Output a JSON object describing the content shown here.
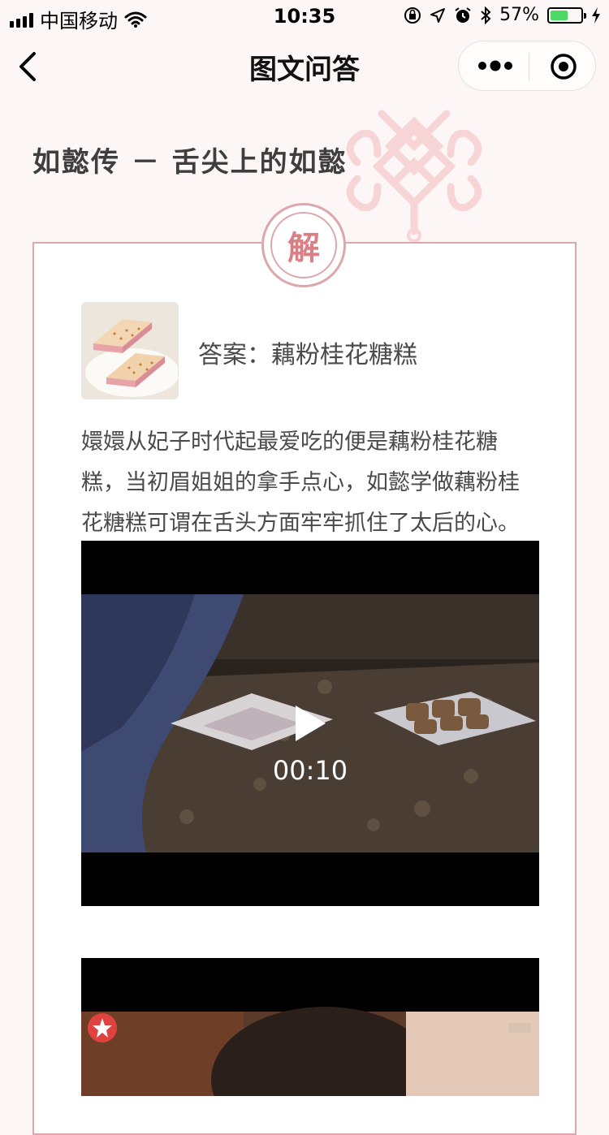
{
  "status_bar": {
    "carrier": "中国移动",
    "time": "10:35",
    "battery": "57%",
    "battery_level": 0.57
  },
  "nav": {
    "title": "图文问答",
    "icons": [
      "chevron-left-icon",
      "more-dots-icon",
      "target-close-icon"
    ]
  },
  "page": {
    "heading": "如懿传 － 舌尖上的如懿"
  },
  "card": {
    "seal_char": "解",
    "answer": "答案：藕粉桂花糖糕",
    "description_lines": [
      "嬛嬛从妃子时代起最爱吃的便是藕粉桂花糖",
      "糕，当初眉姐姐的拿手点心，如懿学做藕粉桂",
      "花糖糕可谓在舌头方面牢牢抓住了太后的心。"
    ]
  },
  "videos": [
    {
      "duration": "00:10"
    },
    {
      "duration": ""
    }
  ],
  "colors": {
    "accent": "#dca8ac",
    "seal_text": "#d97f86",
    "background": "#fdf6f6",
    "battery": "#4cd964"
  }
}
